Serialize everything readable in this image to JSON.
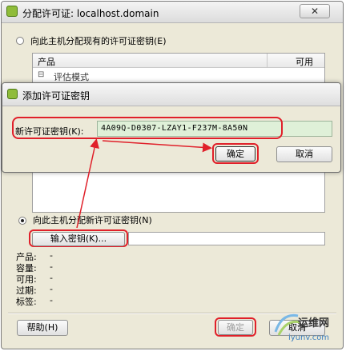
{
  "main_window": {
    "title": "分配许可证: localhost.domain",
    "close_glyph": "✕",
    "option_existing": "向此主机分配现有的许可证密钥(E)",
    "list": {
      "col_product": "产品",
      "col_available": "可用",
      "tree_toggle": "⊟",
      "tree_item": "评估模式"
    },
    "option_new": "向此主机分配新许可证密钥(N)",
    "enter_key_button": "输入密钥(K)...",
    "details": [
      {
        "label": "产品:",
        "value": "-"
      },
      {
        "label": "容量:",
        "value": "-"
      },
      {
        "label": "可用:",
        "value": "-"
      },
      {
        "label": "过期:",
        "value": "-"
      },
      {
        "label": "标签:",
        "value": "-"
      }
    ],
    "help_button": "帮助(H)",
    "ok_button": "确定",
    "cancel_button": "取消"
  },
  "dialog": {
    "title": "添加许可证密钥",
    "key_label": "新许可证密钥(K):",
    "key_value": "4A09Q-D0307-LZAY1-F237M-8A50N",
    "ok_button": "确定",
    "cancel_button": "取消"
  },
  "watermark": {
    "logo_text": "运维网",
    "url": "iyunv.com"
  },
  "colors": {
    "highlight_red": "#e0202a",
    "window_bg": "#ece9d8",
    "key_field_bg": "#dff0d8"
  }
}
